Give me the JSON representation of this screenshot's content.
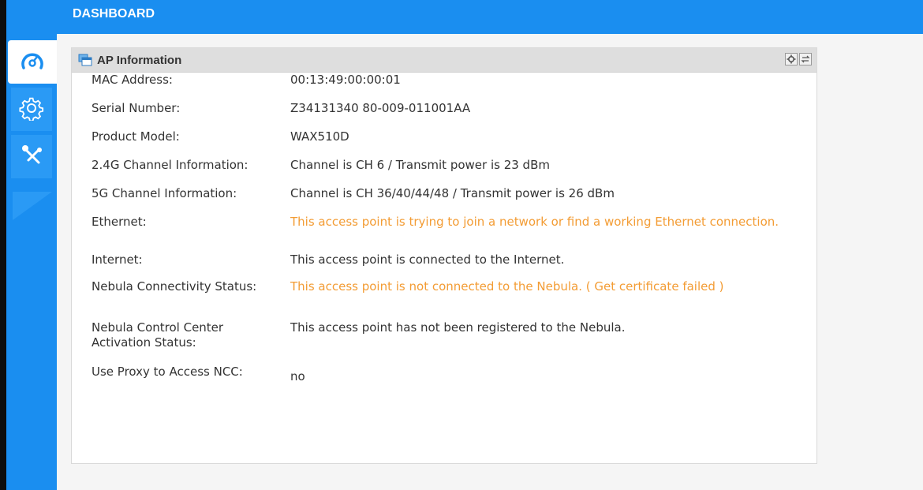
{
  "header": {
    "title": "DASHBOARD"
  },
  "sidebar": {
    "items": [
      {
        "icon": "dashboard-gauge-icon",
        "active": true
      },
      {
        "icon": "gear-icon",
        "active": false
      },
      {
        "icon": "maintenance-tools-icon",
        "active": false
      }
    ]
  },
  "panel": {
    "title": "AP Information",
    "icon": "info-window-icon",
    "tools": [
      "settings-icon",
      "refresh-icon"
    ]
  },
  "ap_info": {
    "rows": [
      {
        "label": "MAC Address:",
        "value": "00:13:49:00:00:01"
      },
      {
        "label": "Serial Number:",
        "value": "Z34131340 80-009-011001AA"
      },
      {
        "label": "Product Model:",
        "value": "WAX510D"
      },
      {
        "label": "2.4G Channel Information:",
        "value": "Channel is CH 6 / Transmit power is 23 dBm"
      },
      {
        "label": "5G Channel Information:",
        "value": "Channel is CH 36/40/44/48 / Transmit power is 26 dBm"
      },
      {
        "label": "Ethernet:",
        "value": "This access point is trying to join a network or find a working Ethernet connection."
      },
      {
        "label": "Internet:",
        "value": "This access point is connected to the Internet."
      },
      {
        "label": "Nebula Connectivity Status:",
        "value": "This access point is not connected to the Nebula. ( Get certificate failed )"
      },
      {
        "label": "Nebula Control Center Activation Status:",
        "value": "This access point has not been registered to the Nebula."
      },
      {
        "label": "Use Proxy to Access NCC:",
        "value": "no"
      }
    ]
  },
  "colors": {
    "accent": "#1a8ef0",
    "warning_text": "#f39c34",
    "text": "#333333"
  }
}
